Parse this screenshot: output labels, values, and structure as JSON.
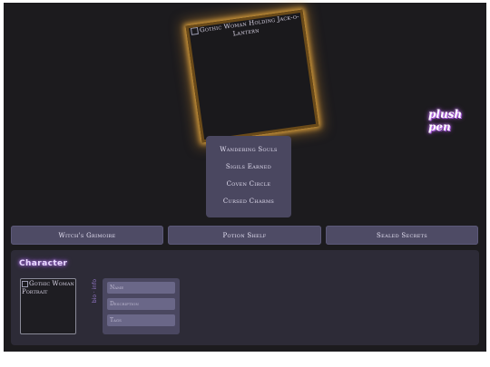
{
  "hero": {
    "alt_text": "Gothic Woman Holding Jack-o-Lantern"
  },
  "brand": {
    "text": "plush pen"
  },
  "stats": [
    {
      "label": "Wandering Souls"
    },
    {
      "label": "Sigils Earned"
    },
    {
      "label": "Coven Circle"
    },
    {
      "label": "Cursed Charms"
    }
  ],
  "nav": [
    {
      "label": "Witch's Grimoire"
    },
    {
      "label": "Potion Shelf"
    },
    {
      "label": "Sealed Secrets"
    }
  ],
  "character": {
    "title": "Character",
    "portrait_alt": "Gothic Woman Portrait",
    "vertical_label": "bio · info",
    "fields": [
      {
        "placeholder": "Name"
      },
      {
        "placeholder": "Description"
      },
      {
        "placeholder": "Tags"
      }
    ]
  },
  "colors": {
    "background": "#1c1b1e",
    "panel": "#2d2b37",
    "button": "#4e4b65",
    "glow_gold": "#d39b3b",
    "accent_purple": "#b05ce8"
  }
}
